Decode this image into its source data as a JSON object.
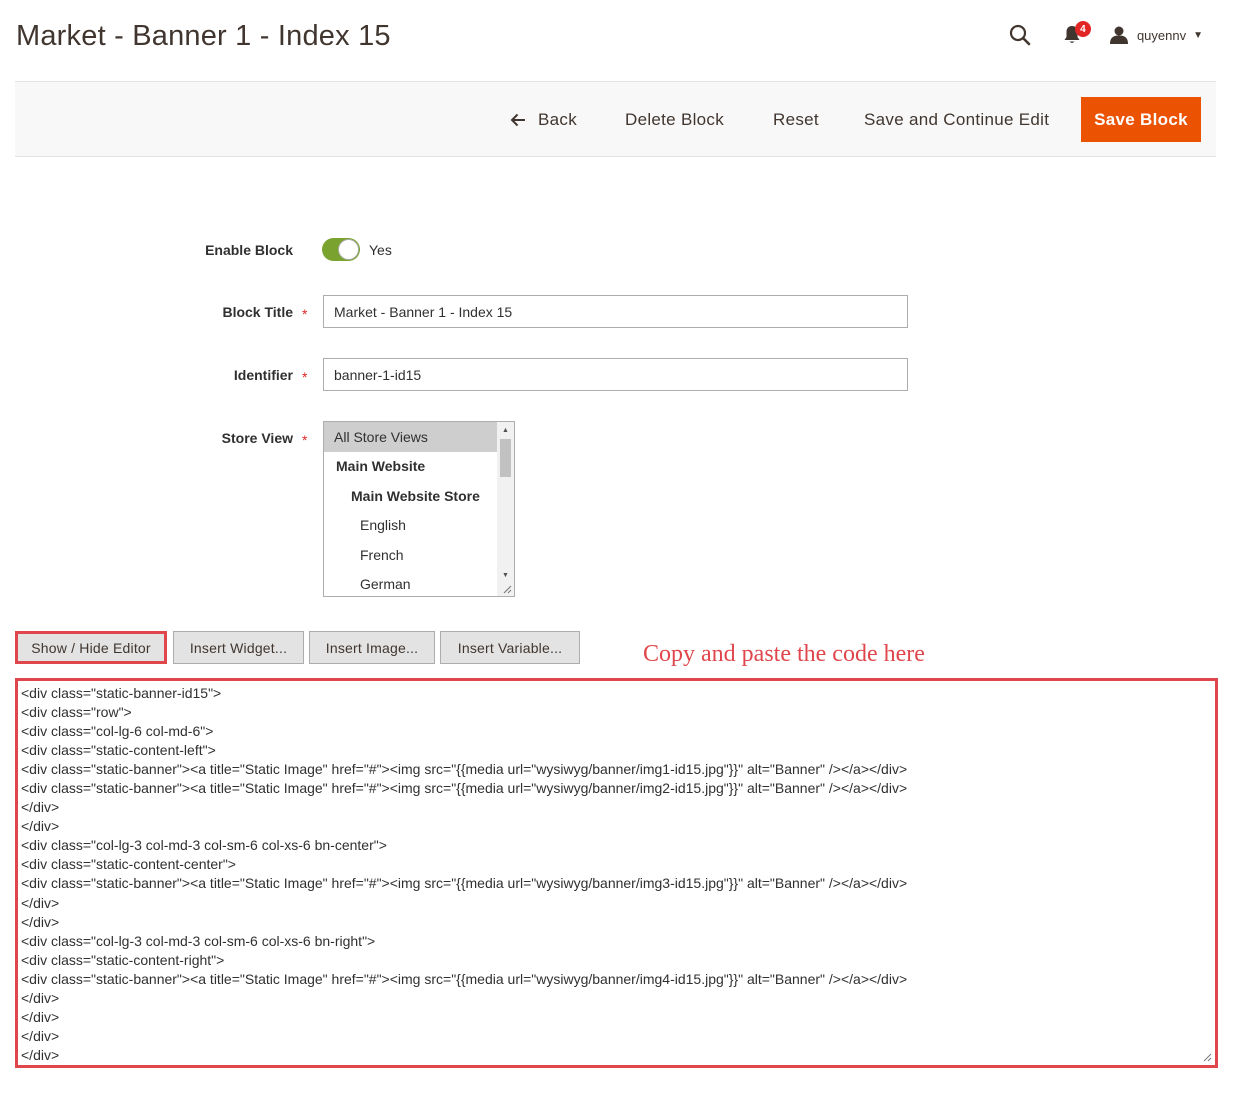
{
  "page": {
    "title": "Market - Banner 1 - Index 15"
  },
  "header": {
    "notifications_count": "4",
    "username": "quyennv"
  },
  "actions": {
    "back": "Back",
    "delete": "Delete Block",
    "reset": "Reset",
    "save_continue": "Save and Continue Edit",
    "save": "Save Block"
  },
  "form": {
    "enable_block": {
      "label": "Enable Block",
      "value": "Yes",
      "enabled": true
    },
    "block_title": {
      "label": "Block Title",
      "value": "Market - Banner 1 - Index 15"
    },
    "identifier": {
      "label": "Identifier",
      "value": "banner-1-id15"
    },
    "store_view": {
      "label": "Store View",
      "options": [
        {
          "label": "All Store Views",
          "selected": true,
          "group": false,
          "indent": 0
        },
        {
          "label": "Main Website",
          "selected": false,
          "group": true,
          "indent": 1
        },
        {
          "label": "Main Website Store",
          "selected": false,
          "group": true,
          "indent": 2
        },
        {
          "label": "English",
          "selected": false,
          "group": false,
          "indent": 3
        },
        {
          "label": "French",
          "selected": false,
          "group": false,
          "indent": 3
        },
        {
          "label": "German",
          "selected": false,
          "group": false,
          "indent": 3
        }
      ]
    }
  },
  "editor": {
    "show_hide": "Show / Hide Editor",
    "insert_widget": "Insert Widget...",
    "insert_image": "Insert Image...",
    "insert_variable": "Insert Variable...",
    "annotation": "Copy and paste the code here",
    "content": "<div class=\"static-banner-id15\">\n<div class=\"row\">\n<div class=\"col-lg-6 col-md-6\">\n<div class=\"static-content-left\">\n<div class=\"static-banner\"><a title=\"Static Image\" href=\"#\"><img src=\"{{media url=\"wysiwyg/banner/img1-id15.jpg\"}}\" alt=\"Banner\" /></a></div>\n<div class=\"static-banner\"><a title=\"Static Image\" href=\"#\"><img src=\"{{media url=\"wysiwyg/banner/img2-id15.jpg\"}}\" alt=\"Banner\" /></a></div>\n</div>\n</div>\n<div class=\"col-lg-3 col-md-3 col-sm-6 col-xs-6 bn-center\">\n<div class=\"static-content-center\">\n<div class=\"static-banner\"><a title=\"Static Image\" href=\"#\"><img src=\"{{media url=\"wysiwyg/banner/img3-id15.jpg\"}}\" alt=\"Banner\" /></a></div>\n</div>\n</div>\n<div class=\"col-lg-3 col-md-3 col-sm-6 col-xs-6 bn-right\">\n<div class=\"static-content-right\">\n<div class=\"static-banner\"><a title=\"Static Image\" href=\"#\"><img src=\"{{media url=\"wysiwyg/banner/img4-id15.jpg\"}}\" alt=\"Banner\" /></a></div>\n</div>\n</div>\n</div>\n</div>"
  },
  "colors": {
    "accent": "#eb5202",
    "toggle_on": "#79a22e",
    "highlight": "#e0474c",
    "badge": "#e22626"
  }
}
